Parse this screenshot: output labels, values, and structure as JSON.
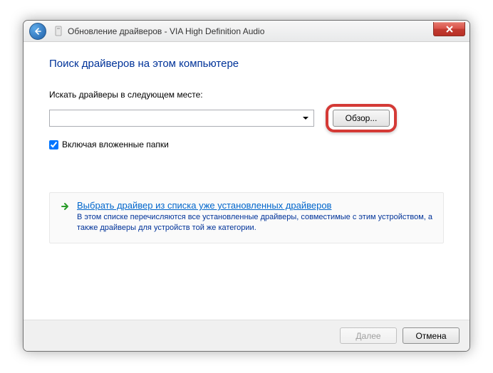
{
  "window": {
    "title": "Обновление драйверов - VIA High Definition Audio"
  },
  "content": {
    "heading": "Поиск драйверов на этом компьютере",
    "search_label": "Искать драйверы в следующем месте:",
    "path_value": "",
    "browse_button": "Обзор...",
    "include_subfolders": "Включая вложенные папки",
    "option_link": "Выбрать драйвер из списка уже установленных драйверов",
    "option_desc": "В этом списке перечисляются все установленные драйверы, совместимые с этим устройством, а также драйверы для устройств той же категории."
  },
  "footer": {
    "next": "Далее",
    "cancel": "Отмена"
  }
}
